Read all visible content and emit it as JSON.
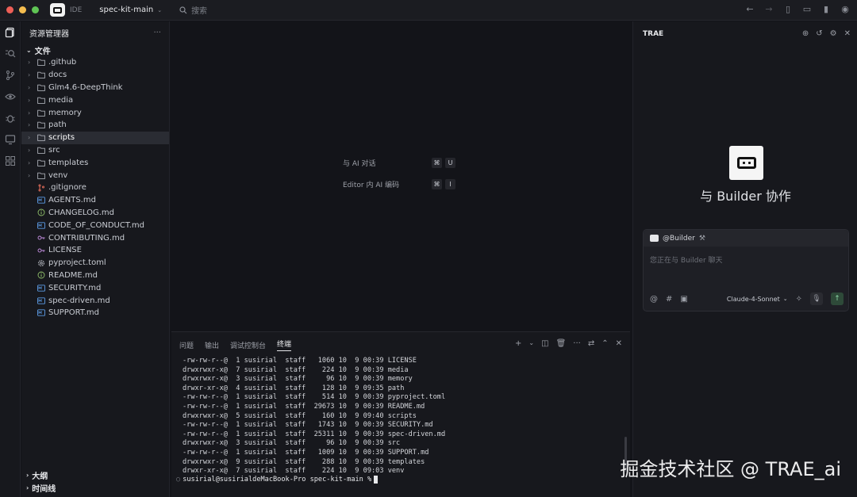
{
  "titlebar": {
    "ide_label": "IDE",
    "project_name": "spec-kit-main",
    "search_placeholder": "搜索"
  },
  "explorer": {
    "title": "资源管理器",
    "more": "···",
    "section_files": "文件",
    "items": [
      {
        "name": ".github",
        "type": "folder"
      },
      {
        "name": "docs",
        "type": "folder"
      },
      {
        "name": "Glm4.6-DeepThink",
        "type": "folder"
      },
      {
        "name": "media",
        "type": "folder"
      },
      {
        "name": "memory",
        "type": "folder"
      },
      {
        "name": "path",
        "type": "folder"
      },
      {
        "name": "scripts",
        "type": "folder"
      },
      {
        "name": "src",
        "type": "folder"
      },
      {
        "name": "templates",
        "type": "folder"
      },
      {
        "name": "venv",
        "type": "folder"
      },
      {
        "name": ".gitignore",
        "type": "git"
      },
      {
        "name": "AGENTS.md",
        "type": "md"
      },
      {
        "name": "CHANGELOG.md",
        "type": "info"
      },
      {
        "name": "CODE_OF_CONDUCT.md",
        "type": "md"
      },
      {
        "name": "CONTRIBUTING.md",
        "type": "key"
      },
      {
        "name": "LICENSE",
        "type": "key"
      },
      {
        "name": "pyproject.toml",
        "type": "gear"
      },
      {
        "name": "README.md",
        "type": "info"
      },
      {
        "name": "SECURITY.md",
        "type": "md"
      },
      {
        "name": "spec-driven.md",
        "type": "md"
      },
      {
        "name": "SUPPORT.md",
        "type": "md"
      }
    ],
    "section_outline": "大纲",
    "section_timeline": "时间线"
  },
  "editor": {
    "shortcuts": [
      {
        "label": "与 AI 对话",
        "keys": [
          "⌘",
          "U"
        ]
      },
      {
        "label": "Editor 内 AI 编码",
        "keys": [
          "⌘",
          "I"
        ]
      }
    ]
  },
  "panel": {
    "tabs": [
      "问题",
      "输出",
      "调试控制台",
      "终端"
    ],
    "active_tab": "终端",
    "terminal_lines": [
      "-rw-rw-r--@  1 susirial  staff   1060 10  9 00:39 LICENSE",
      "drwxrwxr-x@  7 susirial  staff    224 10  9 00:39 media",
      "drwxrwxr-x@  3 susirial  staff     96 10  9 00:39 memory",
      "drwxr-xr-x@  4 susirial  staff    128 10  9 09:35 path",
      "-rw-rw-r--@  1 susirial  staff    514 10  9 00:39 pyproject.toml",
      "-rw-rw-r--@  1 susirial  staff  29673 10  9 00:39 README.md",
      "drwxrwxr-x@  5 susirial  staff    160 10  9 09:40 scripts",
      "-rw-rw-r--@  1 susirial  staff   1743 10  9 00:39 SECURITY.md",
      "-rw-rw-r--@  1 susirial  staff  25311 10  9 00:39 spec-driven.md",
      "drwxrwxr-x@  3 susirial  staff     96 10  9 00:39 src",
      "-rw-rw-r--@  1 susirial  staff   1009 10  9 00:39 SUPPORT.md",
      "drwxrwxr-x@  9 susirial  staff    288 10  9 00:39 templates",
      "drwxr-xr-x@  7 susirial  staff    224 10  9 09:03 venv"
    ],
    "prompt": "susirial@susirialdeMacBook-Pro spec-kit-main %"
  },
  "chat": {
    "title": "TRAE",
    "builder_title": "与 Builder 协作",
    "agent_tag": "@Builder",
    "placeholder": "您正在与 Builder 聊天",
    "model": "Claude-4-Sonnet"
  },
  "watermark": "掘金技术社区 @ TRAE_ai"
}
